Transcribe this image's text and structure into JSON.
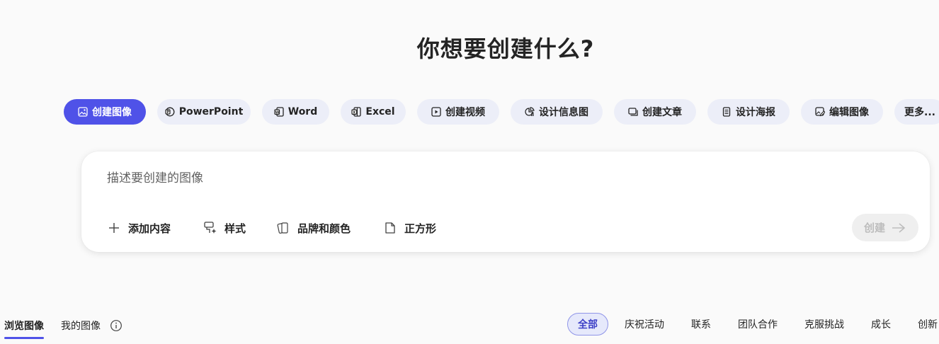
{
  "heading": "你想要创建什么?",
  "chips": [
    {
      "label": "创建图像",
      "icon": "image-icon",
      "active": true
    },
    {
      "label": "PowerPoint",
      "icon": "powerpoint-icon"
    },
    {
      "label": "Word",
      "icon": "word-icon"
    },
    {
      "label": "Excel",
      "icon": "excel-icon"
    },
    {
      "label": "创建视频",
      "icon": "video-icon"
    },
    {
      "label": "设计信息图",
      "icon": "infographic-icon"
    },
    {
      "label": "创建文章",
      "icon": "article-icon"
    },
    {
      "label": "设计海报",
      "icon": "poster-icon"
    },
    {
      "label": "编辑图像",
      "icon": "edit-image-icon"
    },
    {
      "label": "更多...",
      "icon": ""
    }
  ],
  "composer": {
    "placeholder": "描述要创建的图像",
    "tools": [
      {
        "label": "添加内容",
        "icon": "plus-icon"
      },
      {
        "label": "样式",
        "icon": "style-brush-icon"
      },
      {
        "label": "品牌和颜色",
        "icon": "brand-cards-icon"
      },
      {
        "label": "正方形",
        "icon": "square-page-icon"
      }
    ],
    "create_label": "创建"
  },
  "gallery_tabs": [
    {
      "label": "浏览图像",
      "active": true
    },
    {
      "label": "我的图像",
      "active": false
    }
  ],
  "filters": [
    {
      "label": "全部",
      "active": true
    },
    {
      "label": "庆祝活动"
    },
    {
      "label": "联系"
    },
    {
      "label": "团队合作"
    },
    {
      "label": "克服挑战"
    },
    {
      "label": "成长"
    },
    {
      "label": "创新"
    }
  ],
  "colors": {
    "accent": "#4f52e8",
    "chip_bg": "#eceef8",
    "page_bg": "#fafafa"
  }
}
